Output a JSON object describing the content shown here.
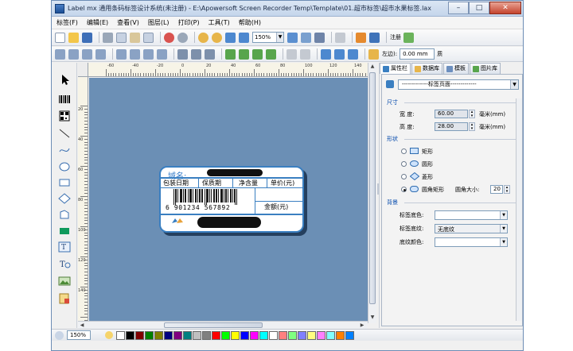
{
  "window": {
    "title": "Label mx 通用条码标签设计系统(未注册) - E:\\Apowersoft Screen Recorder Temp\\Template\\01.超市标签\\超市水果标签.lax",
    "minimize": "–",
    "maximize": "□",
    "close": "✕"
  },
  "menu": [
    "标签(F)",
    "编辑(E)",
    "查看(V)",
    "图层(L)",
    "打印(P)",
    "工具(T)",
    "帮助(H)"
  ],
  "toolbar": {
    "zoom": "150%",
    "register_label": "注册",
    "left_margin_label": "左边):",
    "left_margin_value": "0.00 mm",
    "extra_label": "质"
  },
  "label": {
    "domain": "域名:",
    "headers": [
      "包装日期",
      "保质期",
      "净含量",
      "单价(元)"
    ],
    "barcode_digits": "6  901234  567892",
    "amount": "金额(元)"
  },
  "panel": {
    "tabs": [
      "属性栏",
      "数据库",
      "模板",
      "图片库"
    ],
    "object": "-------------标签页面-------------",
    "size": {
      "title": "尺寸",
      "width_label": "宽    度:",
      "width_value": "60.00",
      "width_unit": "毫米(mm)",
      "height_label": "高    度:",
      "height_value": "28.00",
      "height_unit": "毫米(mm)"
    },
    "shape": {
      "title": "形状",
      "options": [
        "矩形",
        "圆形",
        "菱形",
        "圆角矩形"
      ],
      "selected": "圆角矩形",
      "corner_label": "圆角大小:",
      "corner_value": "20"
    },
    "background": {
      "title": "背景",
      "fill_color_label": "标签底色:",
      "texture_label": "标签底纹:",
      "texture_value": "无底纹",
      "texture_color_label": "底纹颜色:"
    }
  },
  "status": {
    "zoom": "150%",
    "palette": [
      "#000000",
      "#800000",
      "#008000",
      "#808000",
      "#000080",
      "#800080",
      "#008080",
      "#c0c0c0",
      "#808080",
      "#ff0000",
      "#00ff00",
      "#ffff00",
      "#0000ff",
      "#ff00ff",
      "#00ffff",
      "#ffffff",
      "#ff8080",
      "#80ff80",
      "#8080ff",
      "#ffff80",
      "#ff80ff",
      "#80ffff",
      "#ff8000",
      "#0080ff"
    ]
  },
  "ruler": {
    "top": [
      "-60",
      "-40",
      "-20",
      "0",
      "20",
      "40",
      "60",
      "80",
      "100",
      "120",
      "140"
    ],
    "left": [
      "20",
      "40",
      "60",
      "80",
      "100",
      "120",
      "140"
    ]
  }
}
